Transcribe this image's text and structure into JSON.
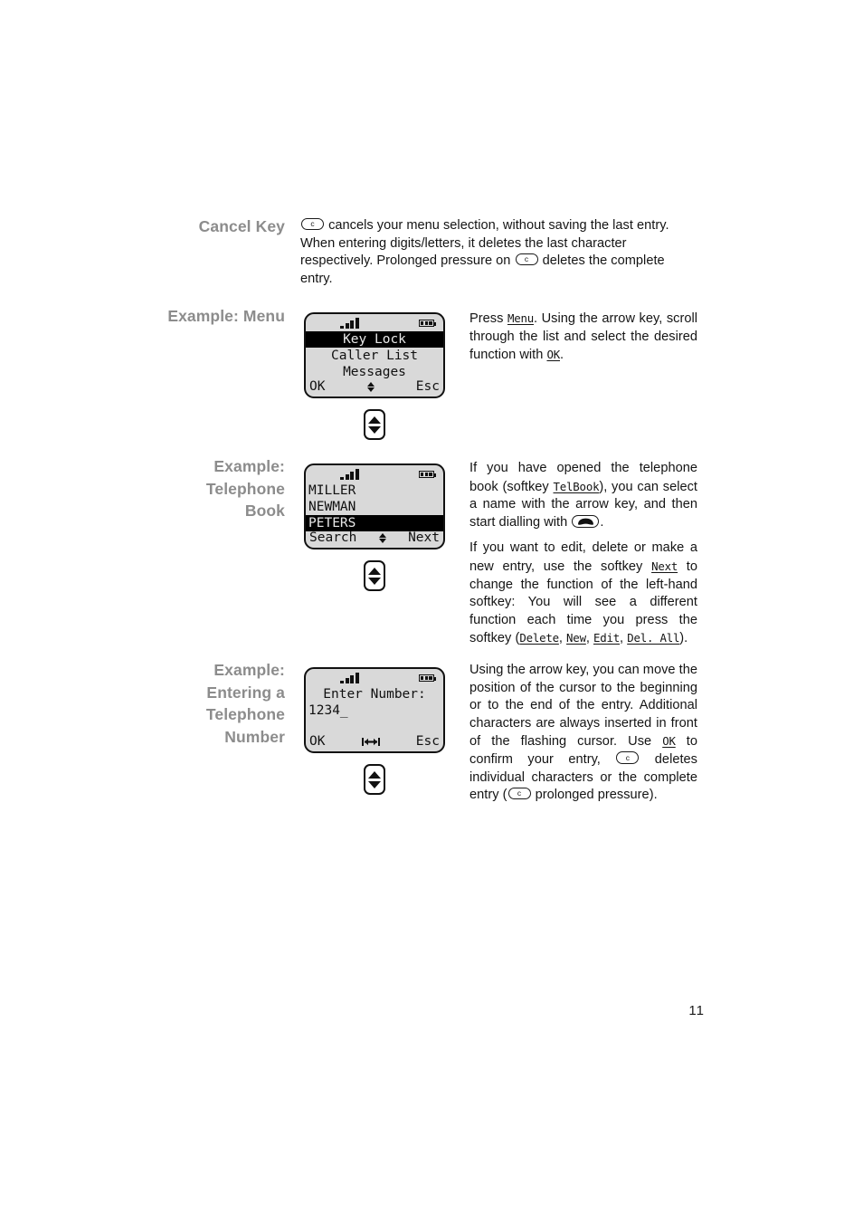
{
  "page": {
    "number": "11"
  },
  "sections": {
    "cancel_key": {
      "heading": "Cancel Key",
      "text_part_1": "cancels your menu selection, without saving the last entry. When entering digits/letters, it deletes the last character respectively. Prolonged pressure on",
      "text_part_2": "deletes the complete entry.",
      "key_icon": "cancel-c-key-icon"
    },
    "example_menu": {
      "heading": "Example: Menu",
      "text_part_1": "Press",
      "softkey_menu": "Menu",
      "text_part_2": ". Using the arrow key, scroll through the list and select the desired function with",
      "softkey_ok": "OK",
      "text_part_3": "."
    },
    "example_telephone_book": {
      "heading_line_1": "Example:",
      "heading_line_2": "Telephone",
      "heading_line_3": "Book",
      "para1_part_1": "If you have opened the telephone book (softkey",
      "para1_softkey": "TelBook",
      "para1_part_2": "), you can select a name with the arrow key, and then start dialling with",
      "para1_part_3": ".",
      "para2_part_1": "If you want to edit, delete or make a new entry, use the softkey",
      "para2_softkey_next": "Next",
      "para2_part_2": "to change the function of the left-hand softkey: You will see a different function each time you press the softkey (",
      "para2_softkey_delete": "Delete",
      "para2_sep_1": ", ",
      "para2_softkey_new": "New",
      "para2_sep_2": ", ",
      "para2_softkey_edit": "Edit",
      "para2_sep_3": ", ",
      "para2_softkey_delall": "Del. All",
      "para2_part_3": ")."
    },
    "example_entering_number": {
      "heading_line_1": "Example:",
      "heading_line_2": "Entering a",
      "heading_line_3": "Telephone",
      "heading_line_4": "Number",
      "text_part_1": "Using the arrow key, you can move the position of the cursor to the beginning or to the end of the entry. Additional characters are always inserted in front of the flashing cursor. Use",
      "softkey_ok": "OK",
      "text_part_2": "to confirm your entry,",
      "text_part_3": "deletes individual characters or the complete entry (",
      "text_part_4": "prolonged pressure)."
    }
  },
  "displays": [
    {
      "name": "menu-display",
      "status": {
        "signal_icon": "signal-bars-icon",
        "battery_icon": "battery-icon"
      },
      "lines": [
        {
          "text": "Key Lock",
          "align": "center",
          "inverted": true
        },
        {
          "text": "Caller List",
          "align": "center",
          "inverted": false
        },
        {
          "text": "Messages",
          "align": "center",
          "inverted": false
        }
      ],
      "softkeys": {
        "left": "OK",
        "middle_icon": "up-down-arrow-icon",
        "right": "Esc"
      },
      "arrow_key_icon": "up-down-arrow-key"
    },
    {
      "name": "telephone-book-display",
      "status": {
        "signal_icon": "signal-bars-icon",
        "battery_icon": "battery-icon"
      },
      "lines": [
        {
          "text": "MILLER",
          "align": "left",
          "inverted": false
        },
        {
          "text": "NEWMAN",
          "align": "left",
          "inverted": false
        },
        {
          "text": "PETERS",
          "align": "left",
          "inverted": true
        }
      ],
      "softkeys": {
        "left": "Search",
        "middle_icon": "up-down-arrow-icon",
        "right": "Next"
      },
      "arrow_key_icon": "up-down-arrow-key"
    },
    {
      "name": "enter-number-display",
      "status": {
        "signal_icon": "signal-bars-icon",
        "battery_icon": "battery-icon"
      },
      "lines": [
        {
          "text": "Enter Number:",
          "align": "center",
          "inverted": false
        },
        {
          "text": "1234_",
          "align": "left",
          "inverted": false
        },
        {
          "text": "",
          "align": "left",
          "inverted": false
        }
      ],
      "softkeys": {
        "left": "OK",
        "middle_icon": "left-right-cursor-icon",
        "right": "Esc"
      },
      "arrow_key_icon": "up-down-arrow-key"
    }
  ]
}
